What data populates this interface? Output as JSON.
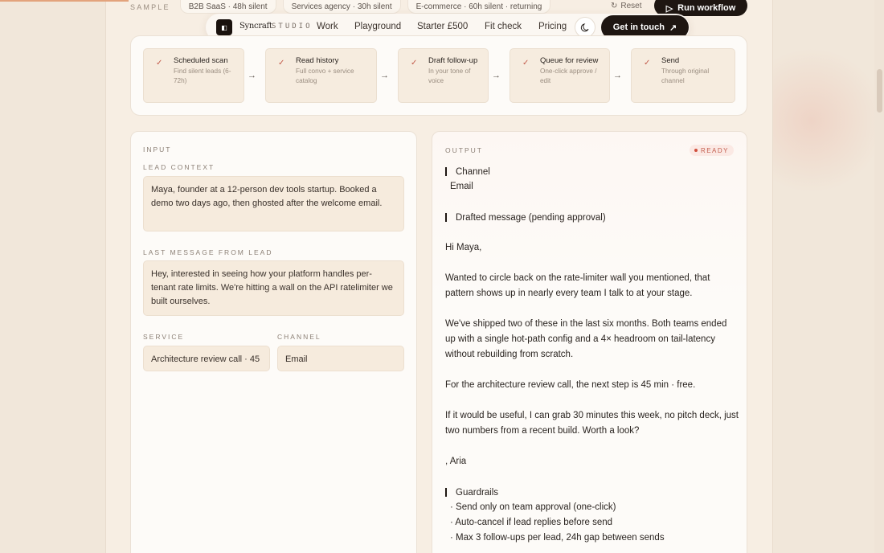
{
  "sample": {
    "label": "SAMPLE",
    "chips": [
      "B2B SaaS · 48h silent",
      "Services agency · 30h silent",
      "E-commerce · 60h silent · returning"
    ],
    "reset_label": "Reset",
    "run_label": "Run workflow"
  },
  "nav": {
    "brand": "Syncraft",
    "studio": "STUDIO",
    "links": [
      "Work",
      "Playground",
      "Starter £500",
      "Fit check",
      "Pricing"
    ],
    "cta": "Get in touch"
  },
  "pipeline": {
    "steps": [
      {
        "title": "Scheduled scan",
        "desc": "Find silent leads (6-72h)"
      },
      {
        "title": "Read history",
        "desc": "Full convo + service catalog"
      },
      {
        "title": "Draft follow-up",
        "desc": "In your tone of voice"
      },
      {
        "title": "Queue for review",
        "desc": "One-click approve / edit"
      },
      {
        "title": "Send",
        "desc": "Through original channel"
      }
    ]
  },
  "input": {
    "caption": "INPUT",
    "lead_context_label": "LEAD CONTEXT",
    "lead_context": "Maya, founder at a 12-person dev tools startup. Booked a demo two days ago, then ghosted after the welcome email.",
    "last_message_label": "LAST MESSAGE FROM LEAD",
    "last_message": "Hey, interested in seeing how your platform handles per-tenant rate limits. We're hitting a wall on the API ratelimiter we built ourselves.",
    "service_label": "SERVICE",
    "service_value": "Architecture review call · 45",
    "channel_label": "CHANNEL",
    "channel_value": "Email"
  },
  "output": {
    "caption": "OUTPUT",
    "status": "READY",
    "channel_head": "Channel",
    "channel_value": "Email",
    "draft_head": "Drafted message (pending approval)",
    "greeting": "Hi Maya,",
    "p1": "Wanted to circle back on the rate-limiter wall you mentioned, that pattern shows up in nearly every team I talk to at your stage.",
    "p2": "We've shipped two of these in the last six months. Both teams ended up with a single hot-path config and a 4× headroom on tail-latency without rebuilding from scratch.",
    "p3": "For the architecture review call, the next step is 45 min · free.",
    "p4": "If it would be useful, I can grab 30 minutes this week, no pitch deck, just two numbers from a recent build. Worth a look?",
    "signoff": ", Aria",
    "guardrails_head": "Guardrails",
    "guardrails": [
      "· Send only on team approval (one-click)",
      "· Auto-cancel if lead replies before send",
      "· Max 3 follow-ups per lead, 24h gap between sends"
    ]
  },
  "colors": {
    "accent": "#c35d4d",
    "dark": "#1e1612",
    "field": "#f6ebdd"
  }
}
